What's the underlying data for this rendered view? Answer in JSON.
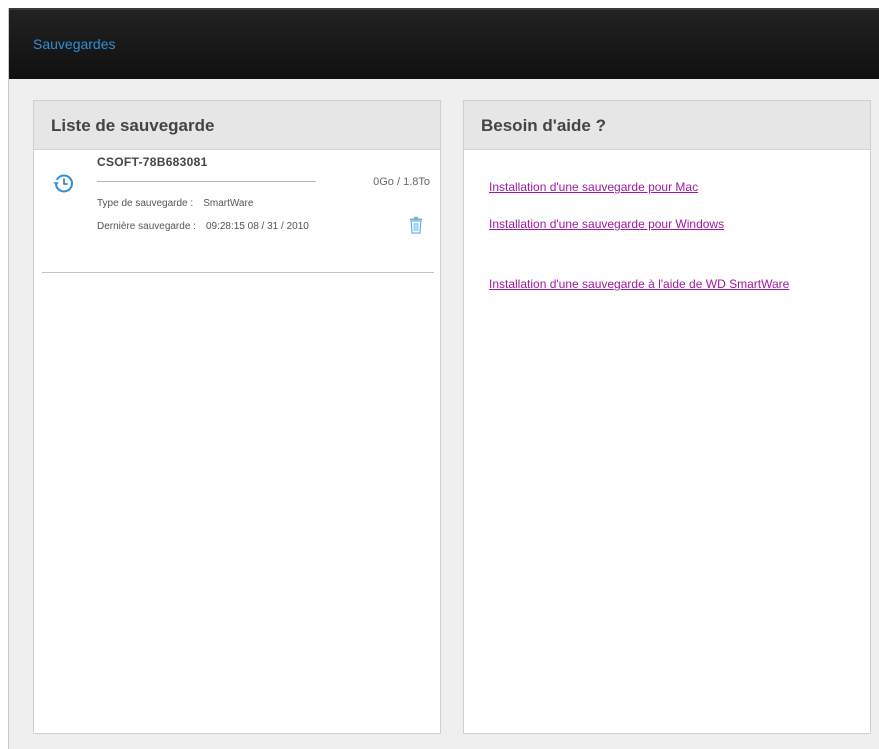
{
  "header": {
    "title": "Sauvegardes"
  },
  "backup_list": {
    "title": "Liste de sauvegarde",
    "items": [
      {
        "device_name": "CSOFT-78B683081",
        "capacity": "0Go / 1.8To",
        "usage_fraction": 0.0,
        "type_label": "Type de sauvegarde :",
        "type_value": "SmartWare",
        "last_label": "Dernière sauvegarde :",
        "last_value": "09:28:15 08 / 31 / 2010",
        "icon": "history-icon",
        "action_icon": "trash-icon"
      }
    ]
  },
  "help": {
    "title": "Besoin d'aide ?",
    "links": [
      "Installation d'une sauvegarde pour Mac",
      "Installation d'une sauvegarde pour Windows",
      "Installation d'une sauvegarde à l'aide de WD SmartWare"
    ]
  },
  "colors": {
    "accent": "#2f8fdb",
    "link": "#a018a0",
    "topbar": "#1a1a1a"
  }
}
